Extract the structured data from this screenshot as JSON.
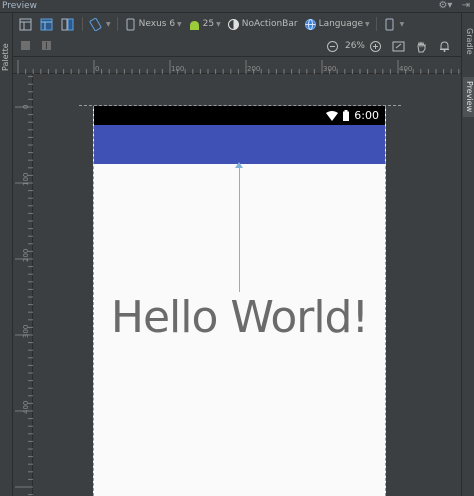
{
  "window": {
    "title": "Preview"
  },
  "side_tabs": {
    "palette": "Palette",
    "gradle": "Gradle",
    "preview": "Preview"
  },
  "toolbar": {
    "device": "Nexus 6",
    "api_level": "25",
    "theme": "NoActionBar",
    "language": "Language",
    "zoom": "26%"
  },
  "ruler": {
    "h_labels": [
      "0",
      "100",
      "200",
      "300",
      "400"
    ],
    "v_labels": [
      "0",
      "100",
      "200",
      "300",
      "400"
    ]
  },
  "device_screen": {
    "time": "6:00",
    "text": "Hello World!",
    "colors": {
      "status_bar": "#000000",
      "app_bar": "#3f51b5",
      "background": "#fafafa",
      "constraint": "#7fb3d6"
    }
  },
  "icons": [
    "gear-icon",
    "minimize-icon",
    "design-surface-icon",
    "blueprint-icon",
    "split-icon",
    "orientation-icon",
    "phone-icon",
    "android-icon",
    "theme-icon",
    "globe-icon",
    "layout-variant-icon",
    "zoom-out-icon",
    "zoom-in-icon",
    "zoom-fit-icon",
    "pan-icon",
    "notification-icon",
    "wifi-icon",
    "battery-icon"
  ]
}
